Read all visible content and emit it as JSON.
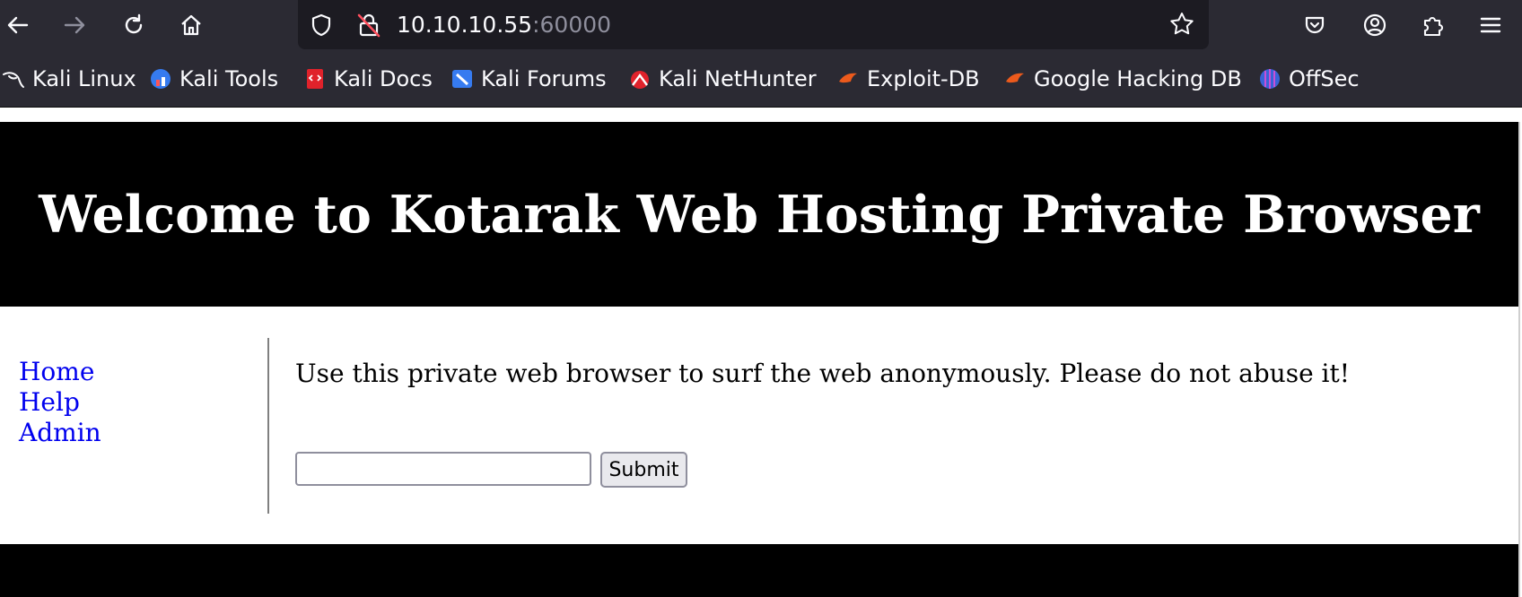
{
  "browser": {
    "url_host": "10.10.10.55",
    "url_port": ":60000",
    "bookmarks": [
      {
        "label": "Kali Linux",
        "icon": "kali-dragon-icon"
      },
      {
        "label": "Kali Tools",
        "icon": "kali-tools-icon"
      },
      {
        "label": "Kali Docs",
        "icon": "kali-docs-icon"
      },
      {
        "label": "Kali Forums",
        "icon": "kali-forums-icon"
      },
      {
        "label": "Kali NetHunter",
        "icon": "kali-nethunter-icon"
      },
      {
        "label": "Exploit-DB",
        "icon": "exploit-db-icon"
      },
      {
        "label": "Google Hacking DB",
        "icon": "ghdb-icon"
      },
      {
        "label": "OffSec",
        "icon": "offsec-icon"
      }
    ]
  },
  "page": {
    "title": "Welcome to Kotarak Web Hosting Private Browser",
    "nav": [
      "Home",
      "Help",
      "Admin"
    ],
    "intro": "Use this private web browser to surf the web anonymously. Please do not abuse it!",
    "input_value": "",
    "submit_label": "Submit"
  },
  "colors": {
    "chrome_bg": "#2b2a33",
    "urlbar_bg": "#1c1b22",
    "link": "#0000ee",
    "hero_bg": "#000000"
  }
}
